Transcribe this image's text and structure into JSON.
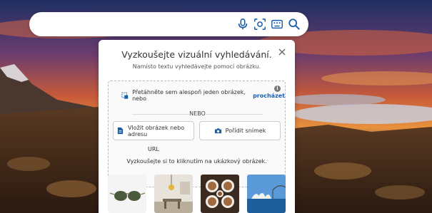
{
  "search": {
    "value": "",
    "placeholder": ""
  },
  "searchbar_icons": [
    "microphone-icon",
    "visual-search-icon",
    "keyboard-icon",
    "search-icon"
  ],
  "panel": {
    "title": "Vyzkoušejte vizuální vyhledávání.",
    "subtitle": "Namísto textu vyhledávejte pomocí obrázku.",
    "drop_text": "Přetáhněte sem alespoň jeden obrázek, nebo",
    "browse_link": "procházet",
    "or_text": "NEBO",
    "paste_button": "Vložit obrázek nebo adresu",
    "paste_button_wrap": "URL",
    "photo_button": "Pořídit snímek",
    "sample_label": "Vyzkoušejte si to kliknutím na ukázkový obrázek."
  },
  "sample_images": [
    "sunglasses",
    "dining-room",
    "coffee-cups",
    "sydney-opera-house"
  ],
  "colors": {
    "accent": "#1a5fb4",
    "icon": "#1b5fa8"
  }
}
